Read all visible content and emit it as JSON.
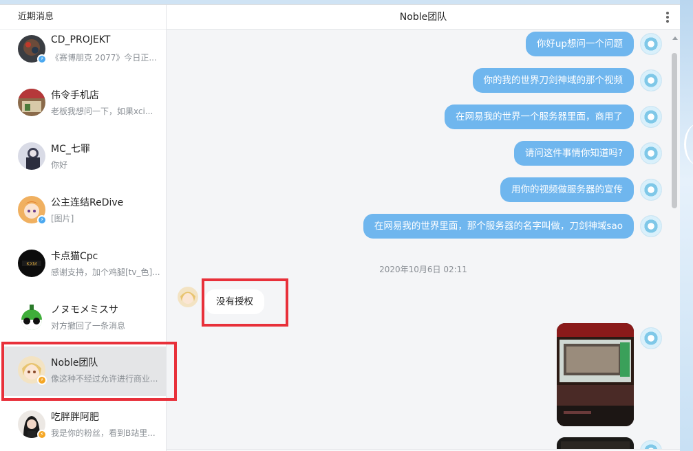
{
  "sidebar": {
    "title": "近期消息",
    "conversations": [
      {
        "name": "CD_PROJEKT",
        "preview": "《赛博朋克 2077》今日正...",
        "badge": "blue",
        "badge_icon": "lightning-icon"
      },
      {
        "name": "伟令手机店",
        "preview": "老板我想问一下，如果xci...",
        "badge": "",
        "badge_icon": ""
      },
      {
        "name": "MC_七罪",
        "preview": "你好",
        "badge": "",
        "badge_icon": ""
      },
      {
        "name": "公主连结ReDive",
        "preview": "[图片]",
        "badge": "blue",
        "badge_icon": "lightning-icon"
      },
      {
        "name": "卡点猫Cpc",
        "preview": "感谢支持，加个鸡腿[tv_色]...",
        "badge": "",
        "badge_icon": ""
      },
      {
        "name": "ノヌモメミスサ",
        "preview": "对方撤回了一条消息",
        "badge": "",
        "badge_icon": ""
      },
      {
        "name": "Noble团队",
        "preview": "像这种不经过允许进行商业...",
        "badge": "orange",
        "badge_icon": "lightning-icon",
        "active": true
      },
      {
        "name": "吃胖胖阿肥",
        "preview": "我是你的粉丝，看到B站里...",
        "badge": "orange",
        "badge_icon": "lightning-icon"
      }
    ]
  },
  "header": {
    "title": "Noble团队",
    "menu_icon": "more-vertical-icon"
  },
  "messages": {
    "outgoing": [
      "你好up想问一个问题",
      "你的我的世界刀剑神域的那个视频",
      "在网易我的世界一个服务器里面，商用了",
      "请问这件事情你知道吗?",
      "用你的视频做服务器的宣传",
      "在网易我的世界里面，那个服务器的名字叫做，刀剑神域sao"
    ],
    "timestamp": "2020年10月6日 02:11",
    "incoming": "没有授权"
  },
  "colors": {
    "outgoing_bubble": "#6fb6ee",
    "highlight": "#e8303a",
    "active_row": "#e4e5e7"
  }
}
